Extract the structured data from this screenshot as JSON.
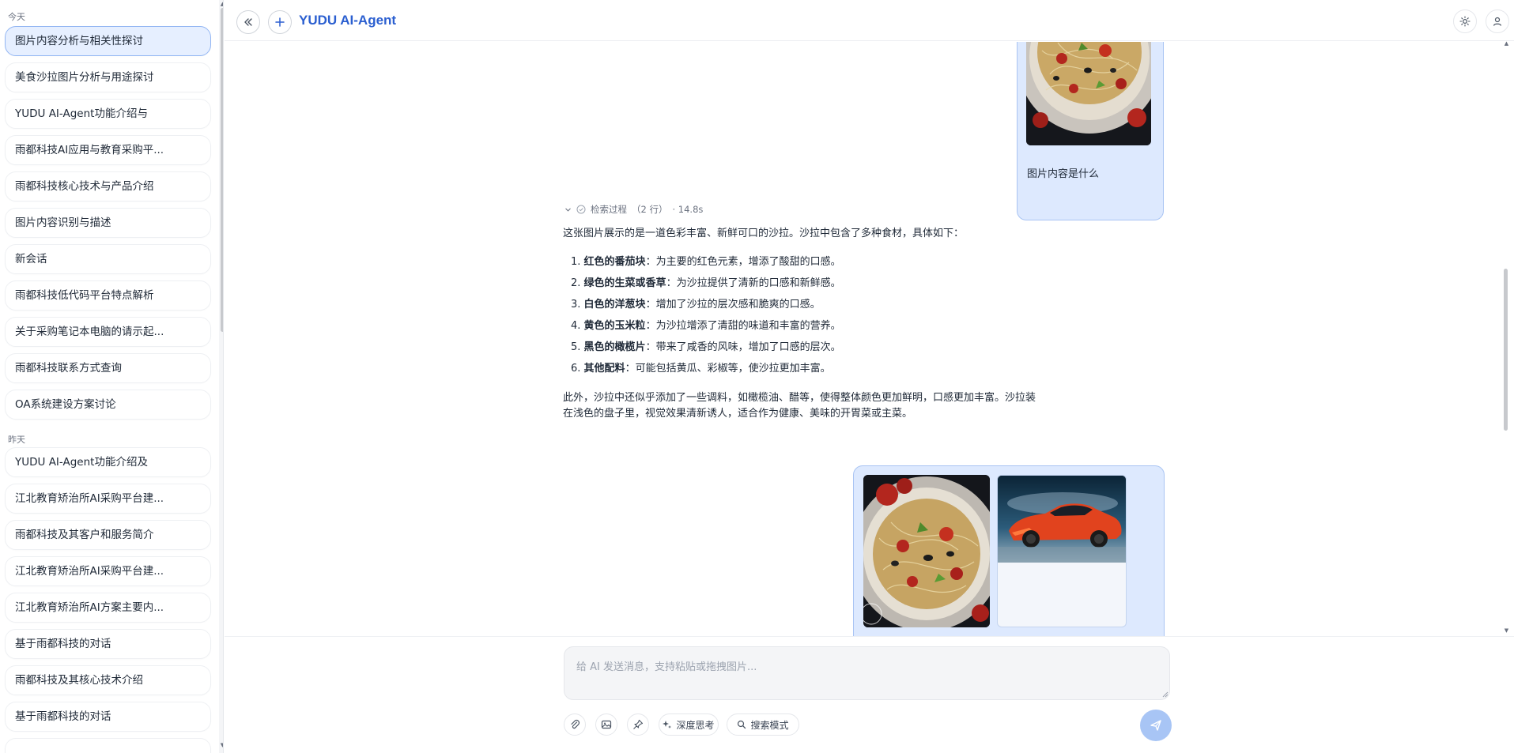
{
  "app": {
    "title": "YUDU AI-Agent"
  },
  "sidebar": {
    "today_label": "今天",
    "yesterday_label": "昨天",
    "today_items": [
      {
        "label": "图片内容分析与相关性探讨",
        "active": true
      },
      {
        "label": "美食沙拉图片分析与用途探讨"
      },
      {
        "label": "YUDU AI-Agent功能介绍与"
      },
      {
        "label": "雨都科技AI应用与教育采购平..."
      },
      {
        "label": "雨都科技核心技术与产品介绍"
      },
      {
        "label": "图片内容识别与描述"
      },
      {
        "label": "新会话"
      },
      {
        "label": "雨都科技低代码平台特点解析"
      },
      {
        "label": "关于采购笔记本电脑的请示起..."
      },
      {
        "label": "雨都科技联系方式查询"
      },
      {
        "label": "OA系统建设方案讨论"
      }
    ],
    "yesterday_items": [
      {
        "label": "YUDU AI-Agent功能介绍及"
      },
      {
        "label": "江北教育矫治所AI采购平台建..."
      },
      {
        "label": "雨都科技及其客户和服务简介"
      },
      {
        "label": "江北教育矫治所AI采购平台建..."
      },
      {
        "label": "江北教育矫治所AI方案主要内..."
      },
      {
        "label": "基于雨都科技的对话"
      },
      {
        "label": "雨都科技及其核心技术介绍"
      },
      {
        "label": "基于雨都科技的对话"
      }
    ]
  },
  "chat": {
    "user_question": "图片内容是什么",
    "process": {
      "label": "检索过程",
      "lines": "（2 行）",
      "duration": "· 14.8s"
    },
    "answer": {
      "intro": "这张图片展示的是一道色彩丰富、新鲜可口的沙拉。沙拉中包含了多种食材，具体如下：",
      "items": [
        {
          "num": "1.",
          "title": "红色的番茄块",
          "desc": "：为主要的红色元素，增添了酸甜的口感。"
        },
        {
          "num": "2.",
          "title": "绿色的生菜或香草",
          "desc": "：为沙拉提供了清新的口感和新鲜感。"
        },
        {
          "num": "3.",
          "title": "白色的洋葱块",
          "desc": "：增加了沙拉的层次感和脆爽的口感。"
        },
        {
          "num": "4.",
          "title": "黄色的玉米粒",
          "desc": "：为沙拉增添了清甜的味道和丰富的营养。"
        },
        {
          "num": "5.",
          "title": "黑色的橄榄片",
          "desc": "：带来了咸香的风味，增加了口感的层次。"
        },
        {
          "num": "6.",
          "title": "其他配料",
          "desc": "：可能包括黄瓜、彩椒等，使沙拉更加丰富。"
        }
      ],
      "outro_1": "此外，沙拉中还似乎添加了一些调料，如橄榄油、醋等，使得整体颜色更加鲜明，口感更加丰富。沙拉装",
      "outro_2": "在浅色的盘子里，视觉效果清新诱人，适合作为健康、美味的开胃菜或主菜。"
    }
  },
  "input": {
    "placeholder": "给 AI 发送消息，支持粘贴或拖拽图片...",
    "deep_think_label": "深度思考",
    "search_mode_label": "搜索模式"
  },
  "colors": {
    "accent": "#2b5fd0",
    "bubble_bg": "#dde9fe",
    "send_btn": "#a8c5f5"
  }
}
